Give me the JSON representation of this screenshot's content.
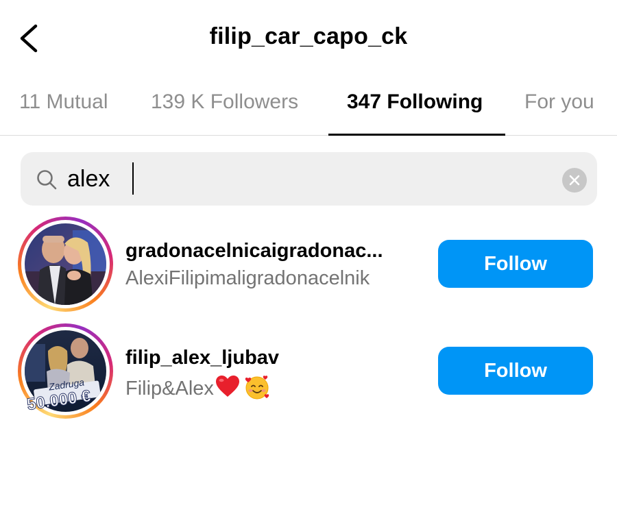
{
  "header": {
    "title": "filip_car_capo_ck",
    "back_icon": "chevron-left-icon"
  },
  "tabs": [
    {
      "label": "11 Mutual",
      "active": false
    },
    {
      "label": "139 K Followers",
      "active": false
    },
    {
      "label": "347 Following",
      "active": true
    },
    {
      "label": "For you",
      "active": false
    }
  ],
  "search": {
    "value": "alex",
    "icon": "search-icon",
    "clear_icon": "clear-icon"
  },
  "results": [
    {
      "username": "gradonacelnicaigradonac...",
      "fullname": "AlexiFilipimaligradonacelnik",
      "button": "Follow"
    },
    {
      "username": "filip_alex_ljubav",
      "fullname": "Filip&Alex",
      "emojis": [
        "red-heart",
        "smiling-face-with-hearts"
      ],
      "avatar_caption_1": "Zadruga",
      "avatar_caption_2": "50.000 €",
      "button": "Follow"
    }
  ],
  "colors": {
    "accent": "#0095f6",
    "secondary_text": "#737373",
    "tab_inactive": "#8e8e8e",
    "search_bg": "#efefef"
  }
}
